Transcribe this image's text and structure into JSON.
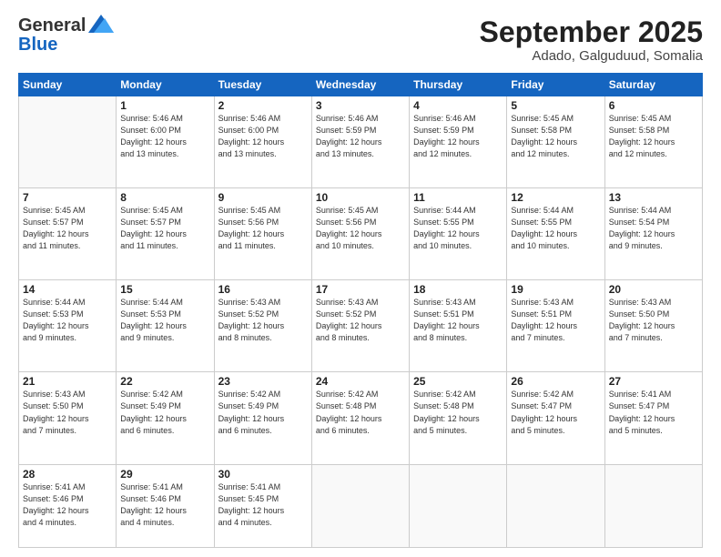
{
  "header": {
    "logo": {
      "general": "General",
      "blue": "Blue"
    },
    "title": "September 2025",
    "location": "Adado, Galguduud, Somalia"
  },
  "days_of_week": [
    "Sunday",
    "Monday",
    "Tuesday",
    "Wednesday",
    "Thursday",
    "Friday",
    "Saturday"
  ],
  "weeks": [
    [
      {
        "day": "",
        "info": ""
      },
      {
        "day": "1",
        "info": "Sunrise: 5:46 AM\nSunset: 6:00 PM\nDaylight: 12 hours\nand 13 minutes."
      },
      {
        "day": "2",
        "info": "Sunrise: 5:46 AM\nSunset: 6:00 PM\nDaylight: 12 hours\nand 13 minutes."
      },
      {
        "day": "3",
        "info": "Sunrise: 5:46 AM\nSunset: 5:59 PM\nDaylight: 12 hours\nand 13 minutes."
      },
      {
        "day": "4",
        "info": "Sunrise: 5:46 AM\nSunset: 5:59 PM\nDaylight: 12 hours\nand 12 minutes."
      },
      {
        "day": "5",
        "info": "Sunrise: 5:45 AM\nSunset: 5:58 PM\nDaylight: 12 hours\nand 12 minutes."
      },
      {
        "day": "6",
        "info": "Sunrise: 5:45 AM\nSunset: 5:58 PM\nDaylight: 12 hours\nand 12 minutes."
      }
    ],
    [
      {
        "day": "7",
        "info": "Sunrise: 5:45 AM\nSunset: 5:57 PM\nDaylight: 12 hours\nand 11 minutes."
      },
      {
        "day": "8",
        "info": "Sunrise: 5:45 AM\nSunset: 5:57 PM\nDaylight: 12 hours\nand 11 minutes."
      },
      {
        "day": "9",
        "info": "Sunrise: 5:45 AM\nSunset: 5:56 PM\nDaylight: 12 hours\nand 11 minutes."
      },
      {
        "day": "10",
        "info": "Sunrise: 5:45 AM\nSunset: 5:56 PM\nDaylight: 12 hours\nand 10 minutes."
      },
      {
        "day": "11",
        "info": "Sunrise: 5:44 AM\nSunset: 5:55 PM\nDaylight: 12 hours\nand 10 minutes."
      },
      {
        "day": "12",
        "info": "Sunrise: 5:44 AM\nSunset: 5:55 PM\nDaylight: 12 hours\nand 10 minutes."
      },
      {
        "day": "13",
        "info": "Sunrise: 5:44 AM\nSunset: 5:54 PM\nDaylight: 12 hours\nand 9 minutes."
      }
    ],
    [
      {
        "day": "14",
        "info": "Sunrise: 5:44 AM\nSunset: 5:53 PM\nDaylight: 12 hours\nand 9 minutes."
      },
      {
        "day": "15",
        "info": "Sunrise: 5:44 AM\nSunset: 5:53 PM\nDaylight: 12 hours\nand 9 minutes."
      },
      {
        "day": "16",
        "info": "Sunrise: 5:43 AM\nSunset: 5:52 PM\nDaylight: 12 hours\nand 8 minutes."
      },
      {
        "day": "17",
        "info": "Sunrise: 5:43 AM\nSunset: 5:52 PM\nDaylight: 12 hours\nand 8 minutes."
      },
      {
        "day": "18",
        "info": "Sunrise: 5:43 AM\nSunset: 5:51 PM\nDaylight: 12 hours\nand 8 minutes."
      },
      {
        "day": "19",
        "info": "Sunrise: 5:43 AM\nSunset: 5:51 PM\nDaylight: 12 hours\nand 7 minutes."
      },
      {
        "day": "20",
        "info": "Sunrise: 5:43 AM\nSunset: 5:50 PM\nDaylight: 12 hours\nand 7 minutes."
      }
    ],
    [
      {
        "day": "21",
        "info": "Sunrise: 5:43 AM\nSunset: 5:50 PM\nDaylight: 12 hours\nand 7 minutes."
      },
      {
        "day": "22",
        "info": "Sunrise: 5:42 AM\nSunset: 5:49 PM\nDaylight: 12 hours\nand 6 minutes."
      },
      {
        "day": "23",
        "info": "Sunrise: 5:42 AM\nSunset: 5:49 PM\nDaylight: 12 hours\nand 6 minutes."
      },
      {
        "day": "24",
        "info": "Sunrise: 5:42 AM\nSunset: 5:48 PM\nDaylight: 12 hours\nand 6 minutes."
      },
      {
        "day": "25",
        "info": "Sunrise: 5:42 AM\nSunset: 5:48 PM\nDaylight: 12 hours\nand 5 minutes."
      },
      {
        "day": "26",
        "info": "Sunrise: 5:42 AM\nSunset: 5:47 PM\nDaylight: 12 hours\nand 5 minutes."
      },
      {
        "day": "27",
        "info": "Sunrise: 5:41 AM\nSunset: 5:47 PM\nDaylight: 12 hours\nand 5 minutes."
      }
    ],
    [
      {
        "day": "28",
        "info": "Sunrise: 5:41 AM\nSunset: 5:46 PM\nDaylight: 12 hours\nand 4 minutes."
      },
      {
        "day": "29",
        "info": "Sunrise: 5:41 AM\nSunset: 5:46 PM\nDaylight: 12 hours\nand 4 minutes."
      },
      {
        "day": "30",
        "info": "Sunrise: 5:41 AM\nSunset: 5:45 PM\nDaylight: 12 hours\nand 4 minutes."
      },
      {
        "day": "",
        "info": ""
      },
      {
        "day": "",
        "info": ""
      },
      {
        "day": "",
        "info": ""
      },
      {
        "day": "",
        "info": ""
      }
    ]
  ]
}
